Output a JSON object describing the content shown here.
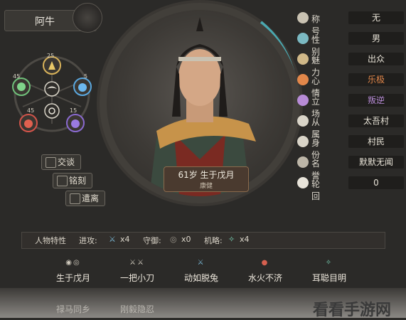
{
  "character": {
    "name": "阿牛",
    "age": "61岁",
    "birth": "生于戊月",
    "health": "康健"
  },
  "wheel": {
    "top": "25",
    "left": "45",
    "right": "5",
    "bottom_left": "45",
    "bottom_right": "15"
  },
  "stats": [
    {
      "label": "称号",
      "value": "无",
      "icon": "crown-icon",
      "color": "#ded9ce"
    },
    {
      "label": "性别",
      "value": "男",
      "icon": "gender-icon",
      "color": "#e7e2d6"
    },
    {
      "label": "魅力",
      "value": "出众",
      "icon": "charm-icon",
      "color": "#e7e2d6"
    },
    {
      "label": "心情",
      "value": "乐极",
      "icon": "mood-icon",
      "color": "#e2874a"
    },
    {
      "label": "立场",
      "value": "叛逆",
      "icon": "stance-icon",
      "color": "#b78bd6"
    },
    {
      "label": "从属",
      "value": "太吾村",
      "icon": "affiliation-icon",
      "color": "#e7e2d6"
    },
    {
      "label": "身份",
      "value": "村民",
      "icon": "identity-icon",
      "color": "#e7e2d6"
    },
    {
      "label": "名誉",
      "value": "默默无闻",
      "icon": "fame-icon",
      "color": "#e7e2d6"
    },
    {
      "label": "轮回",
      "value": "0",
      "icon": "reincarnation-icon",
      "color": "#e7e2d6"
    }
  ],
  "actions": {
    "talk": "交谈",
    "carve": "铭刻",
    "leave": "遣离"
  },
  "trait_bar": {
    "title": "人物特性",
    "attack_label": "进攻:",
    "attack_val": "x4",
    "defense_label": "守御:",
    "defense_val": "x0",
    "strategy_label": "机略:",
    "strategy_val": "x4"
  },
  "traits": [
    "生于戊月",
    "一把小刀",
    "动如脱兔",
    "水火不济",
    "耳聪目明"
  ],
  "traits_row2": [
    "禄马同乡",
    "刚毅隐忍"
  ],
  "watermark": "看看手游网"
}
